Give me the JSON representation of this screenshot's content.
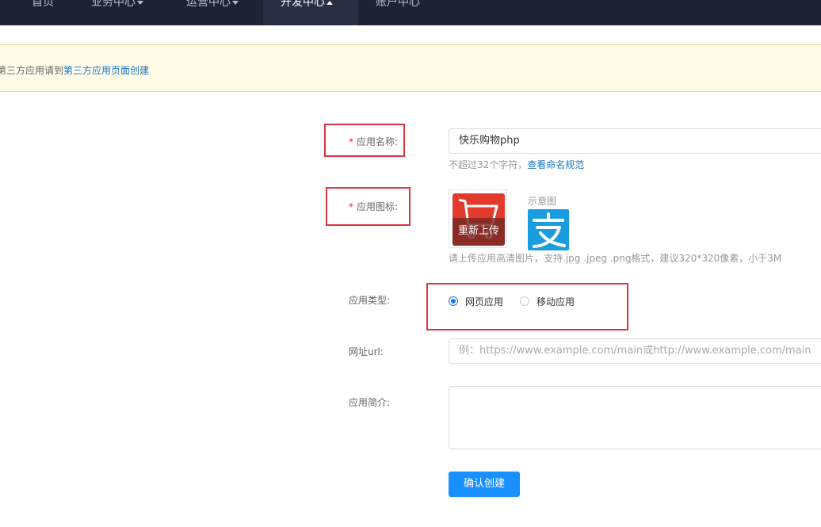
{
  "nav": {
    "items": [
      {
        "label": "首页"
      },
      {
        "label": "业务中心"
      },
      {
        "label": "运营中心"
      },
      {
        "label": "开发中心"
      },
      {
        "label": "账户中心"
      }
    ]
  },
  "notice": {
    "prefix": "第三方应用请到",
    "link": "第三方应用页面创建"
  },
  "form": {
    "app_name": {
      "label": "应用名称:",
      "value": "快乐购物php",
      "hint": "不超过32个字符，",
      "hint_link": "查看命名规范"
    },
    "app_icon": {
      "label": "应用图标:",
      "reupload": "重新上传",
      "sample_label": "示意图",
      "hint": "请上传应用高清图片，支持.jpg .jpeg .png格式，建议320*320像素，小于3M"
    },
    "app_type": {
      "label": "应用类型:",
      "options": [
        {
          "label": "网页应用",
          "checked": true
        },
        {
          "label": "移动应用",
          "checked": false
        }
      ]
    },
    "url": {
      "label": "网址url:",
      "placeholder": "例：https://www.example.com/main或http://www.example.com/main"
    },
    "intro": {
      "label": "应用简介:"
    },
    "submit": "确认创建"
  },
  "colors": {
    "nav_bg": "#1f2233",
    "primary": "#1890ff",
    "link": "#1677c9",
    "highlight_box": "#d9363e",
    "notice_bg": "#fffbe6"
  }
}
